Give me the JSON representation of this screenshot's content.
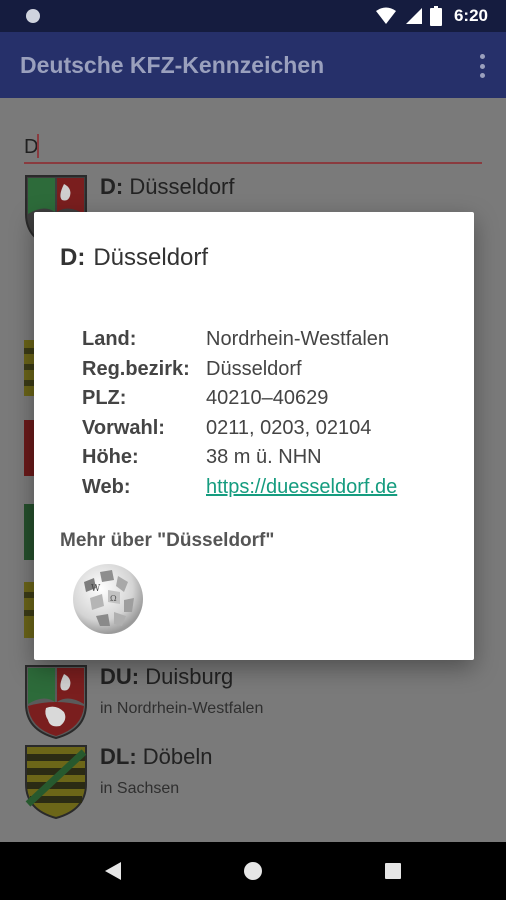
{
  "status_bar": {
    "time": "6:20",
    "icons": [
      "notification-dot-icon",
      "wifi-icon",
      "cell-signal-icon",
      "battery-icon"
    ]
  },
  "app_bar": {
    "title": "Deutsche KFZ-Kennzeichen",
    "menu_icon": "more-vert-icon"
  },
  "search": {
    "value": "D"
  },
  "list": {
    "items": [
      {
        "code": "D",
        "city": "Düsseldorf",
        "region": "",
        "crest": "nrw-coat-of-arms"
      },
      {
        "code": "DU",
        "city": "Duisburg",
        "region": "in Nordrhein-Westfalen",
        "crest": "nrw-coat-of-arms"
      },
      {
        "code": "DL",
        "city": "Döbeln",
        "region": "in Sachsen",
        "crest": "saxony-coat-of-arms"
      }
    ]
  },
  "dialog": {
    "code": "D:",
    "city": "Düsseldorf",
    "rows": [
      {
        "label": "Land:",
        "value": "Nordrhein-Westfalen"
      },
      {
        "label": "Reg.bezirk:",
        "value": "Düsseldorf"
      },
      {
        "label": "PLZ:",
        "value": "40210–40629"
      },
      {
        "label": "Vorwahl:",
        "value": "0211, 0203, 02104"
      },
      {
        "label": "Höhe:",
        "value": "38 m ü. NHN"
      },
      {
        "label": "Web:",
        "value": "https://duesseldorf.de"
      }
    ],
    "more_label": "Mehr über \"Düsseldorf\"",
    "wiki_icon": "wikipedia-globe-icon"
  },
  "nav_bar": {
    "icons": [
      "back-icon",
      "home-icon",
      "recents-icon"
    ]
  },
  "colors": {
    "status_bar": "#151c3f",
    "app_bar": "#26306a",
    "scrim": "#7a7a7a",
    "link": "#159c7f",
    "accent_underline": "#8a3b3f"
  }
}
